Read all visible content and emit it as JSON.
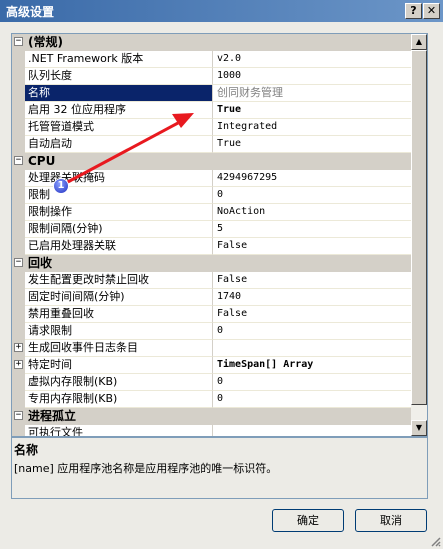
{
  "window": {
    "title": "高级设置",
    "help_label": "?",
    "close_label": "✕"
  },
  "grid": {
    "rows": [
      {
        "kind": "cat",
        "label": "(常规)",
        "expander": "−"
      },
      {
        "kind": "prop",
        "name": ".NET Framework 版本",
        "value": "v2.0"
      },
      {
        "kind": "prop",
        "name": "队列长度",
        "value": "1000"
      },
      {
        "kind": "prop",
        "name": "名称",
        "value": "创同财务管理",
        "selected": true
      },
      {
        "kind": "prop",
        "name": "启用 32 位应用程序",
        "value": "True",
        "bold": true
      },
      {
        "kind": "prop",
        "name": "托管管道模式",
        "value": "Integrated"
      },
      {
        "kind": "prop",
        "name": "自动启动",
        "value": "True"
      },
      {
        "kind": "cat",
        "label": "CPU",
        "expander": "−"
      },
      {
        "kind": "prop",
        "name": "处理器关联掩码",
        "value": "4294967295"
      },
      {
        "kind": "prop",
        "name": "限制",
        "value": "0"
      },
      {
        "kind": "prop",
        "name": "限制操作",
        "value": "NoAction"
      },
      {
        "kind": "prop",
        "name": "限制间隔(分钟)",
        "value": "5"
      },
      {
        "kind": "prop",
        "name": "已启用处理器关联",
        "value": "False"
      },
      {
        "kind": "cat",
        "label": "回收",
        "expander": "−"
      },
      {
        "kind": "prop",
        "name": "发生配置更改时禁止回收",
        "value": "False"
      },
      {
        "kind": "prop",
        "name": "固定时间间隔(分钟)",
        "value": "1740"
      },
      {
        "kind": "prop",
        "name": "禁用重叠回收",
        "value": "False"
      },
      {
        "kind": "prop",
        "name": "请求限制",
        "value": "0"
      },
      {
        "kind": "prop",
        "name": "生成回收事件日志条目",
        "value": "",
        "expander": "+"
      },
      {
        "kind": "prop",
        "name": "特定时间",
        "value": "TimeSpan[] Array",
        "bold": true,
        "expander": "+"
      },
      {
        "kind": "prop",
        "name": "虚拟内存限制(KB)",
        "value": "0"
      },
      {
        "kind": "prop",
        "name": "专用内存限制(KB)",
        "value": "0"
      },
      {
        "kind": "cat",
        "label": "进程孤立",
        "expander": "−"
      },
      {
        "kind": "prop",
        "name": "可执行文件",
        "value": ""
      }
    ]
  },
  "description": {
    "title": "名称",
    "text": "[name] 应用程序池名称是应用程序池的唯一标识符。"
  },
  "buttons": {
    "ok": "确定",
    "cancel": "取消"
  },
  "annotation": {
    "badge": "1",
    "arrow_color": "#e8191f"
  },
  "scrollbar": {
    "up": "▲",
    "down": "▼"
  }
}
